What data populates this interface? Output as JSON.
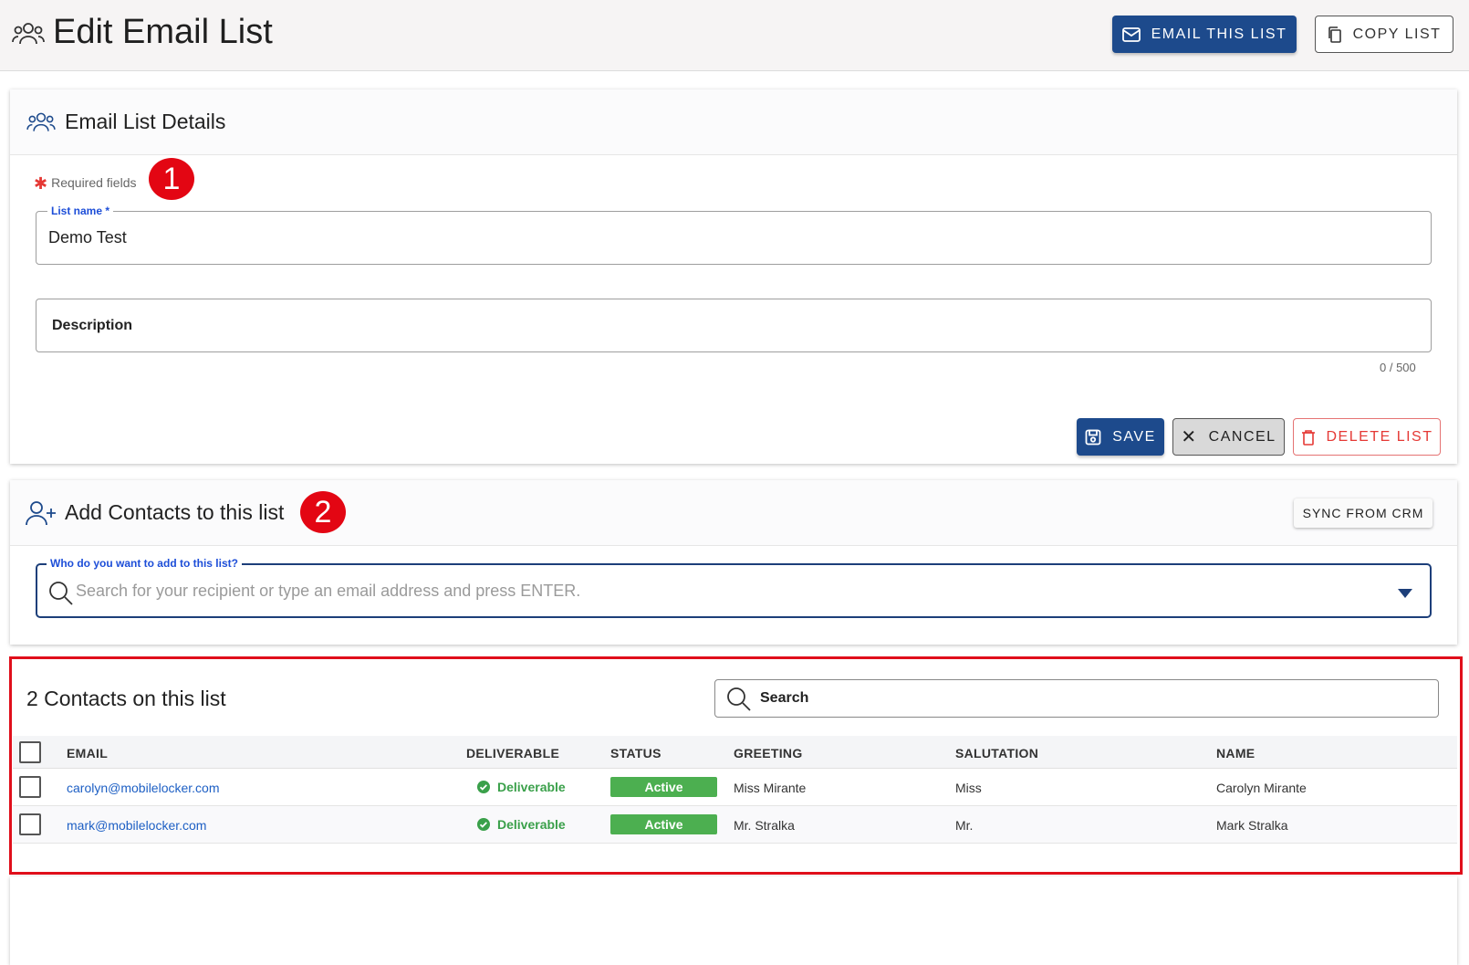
{
  "header": {
    "title": "Edit Email List",
    "email_button": "EMAIL THIS LIST",
    "copy_button": "COPY LIST"
  },
  "details": {
    "title": "Email List Details",
    "required_text": "Required fields",
    "badge1": "1",
    "list_name_label": "List name *",
    "list_name_value": "Demo Test",
    "description_label": "Description",
    "counter": "0 / 500",
    "save": "SAVE",
    "cancel": "CANCEL",
    "delete": "DELETE LIST"
  },
  "add_contacts": {
    "title": "Add Contacts to this list",
    "badge2": "2",
    "sync": "SYNC FROM CRM",
    "combo_label": "Who do you want to add to this list?",
    "combo_placeholder": "Search for your recipient or type an email address and press ENTER."
  },
  "contacts": {
    "title": "2 Contacts on this list",
    "search_placeholder": "Search",
    "columns": [
      "EMAIL",
      "DELIVERABLE",
      "STATUS",
      "GREETING",
      "SALUTATION",
      "NAME"
    ],
    "rows": [
      {
        "email": "carolyn@mobilelocker.com",
        "deliverable": "Deliverable",
        "status": "Active",
        "greeting": "Miss Mirante",
        "salutation": "Miss",
        "name": "Carolyn Mirante"
      },
      {
        "email": "mark@mobilelocker.com",
        "deliverable": "Deliverable",
        "status": "Active",
        "greeting": "Mr. Stralka",
        "salutation": "Mr.",
        "name": "Mark Stralka"
      }
    ]
  },
  "colors": {
    "primary": "#1d4a8c",
    "danger": "#e53935",
    "success": "#4caf50",
    "highlight": "#e00f1b"
  }
}
